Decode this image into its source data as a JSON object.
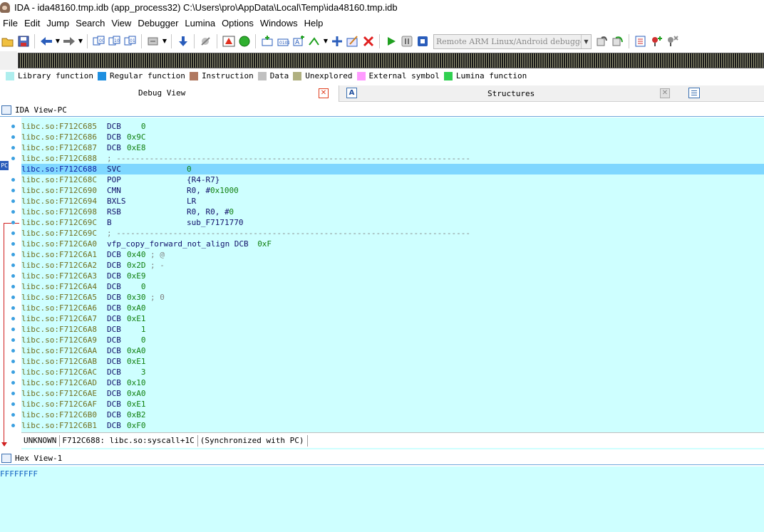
{
  "window": {
    "title": "IDA - ida48160.tmp.idb (app_process32) C:\\Users\\pro\\AppData\\Local\\Temp\\ida48160.tmp.idb"
  },
  "menu": [
    "File",
    "Edit",
    "Jump",
    "Search",
    "View",
    "Debugger",
    "Lumina",
    "Options",
    "Windows",
    "Help"
  ],
  "toolbar": {
    "debugger_select": "Remote ARM Linux/Android debugger",
    "icons": [
      "open-icon",
      "save-icon",
      "back-icon",
      "forward-icon",
      "code-icon",
      "data-icon",
      "string-icon",
      "jump-icon",
      "run-icon",
      "pause-icon",
      "stop-icon"
    ]
  },
  "legend": [
    {
      "label": "Library function",
      "color": "#aeeeee"
    },
    {
      "label": "Regular function",
      "color": "#1e8fe0"
    },
    {
      "label": "Instruction",
      "color": "#b07860"
    },
    {
      "label": "Data",
      "color": "#c0c0c0"
    },
    {
      "label": "Unexplored",
      "color": "#b0b080"
    },
    {
      "label": "External symbol",
      "color": "#ff9aff"
    },
    {
      "label": "Lumina function",
      "color": "#30d050"
    }
  ],
  "tabs": {
    "debug_view": "Debug View",
    "structures": "Structures",
    "structures_icon": "A"
  },
  "ida_view": {
    "title": "IDA View-PC",
    "pc_marker": "PC",
    "lines": [
      {
        "addr": "libc.so:F712C685",
        "mn": "DCB",
        "op": "   0",
        "kind": "dcb"
      },
      {
        "addr": "libc.so:F712C686",
        "mn": "DCB",
        "op": "0x9C",
        "kind": "dcb"
      },
      {
        "addr": "libc.so:F712C687",
        "mn": "DCB",
        "op": "0xE8",
        "kind": "dcb"
      },
      {
        "addr": "libc.so:F712C688",
        "sep": "; ---------------------------------------------------------------------------",
        "kind": "sep"
      },
      {
        "addr": "libc.so:F712C688",
        "mn": "SVC",
        "op": "0",
        "kind": "insn-num",
        "current": true
      },
      {
        "addr": "libc.so:F712C68C",
        "mn": "POP",
        "op": "{R4-R7}",
        "kind": "insn"
      },
      {
        "addr": "libc.so:F712C690",
        "mn": "CMN",
        "op": "R0, #",
        "opnum": "0x1000",
        "kind": "insn-mixed"
      },
      {
        "addr": "libc.so:F712C694",
        "mn": "BXLS",
        "op": "LR",
        "kind": "insn"
      },
      {
        "addr": "libc.so:F712C698",
        "mn": "RSB",
        "op": "R0, R0, #",
        "opnum": "0",
        "kind": "insn-mixed"
      },
      {
        "addr": "libc.so:F712C69C",
        "mn": "B",
        "op": "sub_F7171770",
        "kind": "insn"
      },
      {
        "addr": "libc.so:F712C69C",
        "sep": "; ---------------------------------------------------------------------------",
        "kind": "sep"
      },
      {
        "addr": "libc.so:F712C6A0",
        "label": "vfp_copy_forward_not_align DCB  ",
        "labelnum": "0xF",
        "kind": "label"
      },
      {
        "addr": "libc.so:F712C6A1",
        "mn": "DCB",
        "op": "0x40",
        "cmt": " ; @",
        "kind": "dcb"
      },
      {
        "addr": "libc.so:F712C6A2",
        "mn": "DCB",
        "op": "0x2D",
        "cmt": " ; -",
        "kind": "dcb"
      },
      {
        "addr": "libc.so:F712C6A3",
        "mn": "DCB",
        "op": "0xE9",
        "kind": "dcb"
      },
      {
        "addr": "libc.so:F712C6A4",
        "mn": "DCB",
        "op": "   0",
        "kind": "dcb"
      },
      {
        "addr": "libc.so:F712C6A5",
        "mn": "DCB",
        "op": "0x30",
        "cmt": " ; 0",
        "kind": "dcb"
      },
      {
        "addr": "libc.so:F712C6A6",
        "mn": "DCB",
        "op": "0xA0",
        "kind": "dcb"
      },
      {
        "addr": "libc.so:F712C6A7",
        "mn": "DCB",
        "op": "0xE1",
        "kind": "dcb"
      },
      {
        "addr": "libc.so:F712C6A8",
        "mn": "DCB",
        "op": "   1",
        "kind": "dcb"
      },
      {
        "addr": "libc.so:F712C6A9",
        "mn": "DCB",
        "op": "   0",
        "kind": "dcb"
      },
      {
        "addr": "libc.so:F712C6AA",
        "mn": "DCB",
        "op": "0xA0",
        "kind": "dcb"
      },
      {
        "addr": "libc.so:F712C6AB",
        "mn": "DCB",
        "op": "0xE1",
        "kind": "dcb"
      },
      {
        "addr": "libc.so:F712C6AC",
        "mn": "DCB",
        "op": "   3",
        "kind": "dcb"
      },
      {
        "addr": "libc.so:F712C6AD",
        "mn": "DCB",
        "op": "0x10",
        "kind": "dcb"
      },
      {
        "addr": "libc.so:F712C6AE",
        "mn": "DCB",
        "op": "0xA0",
        "kind": "dcb"
      },
      {
        "addr": "libc.so:F712C6AF",
        "mn": "DCB",
        "op": "0xE1",
        "kind": "dcb"
      },
      {
        "addr": "libc.so:F712C6B0",
        "mn": "DCB",
        "op": "0xB2",
        "kind": "dcb"
      },
      {
        "addr": "libc.so:F712C6B1",
        "mn": "DCB",
        "op": "0xF0",
        "kind": "dcb"
      }
    ],
    "status": {
      "mode": "UNKNOWN",
      "location": "F712C688: libc.so:syscall+1C",
      "sync": "(Synchronized with PC)"
    }
  },
  "hex_view": {
    "title": "Hex View-1",
    "line": "FFFFFFFF"
  }
}
